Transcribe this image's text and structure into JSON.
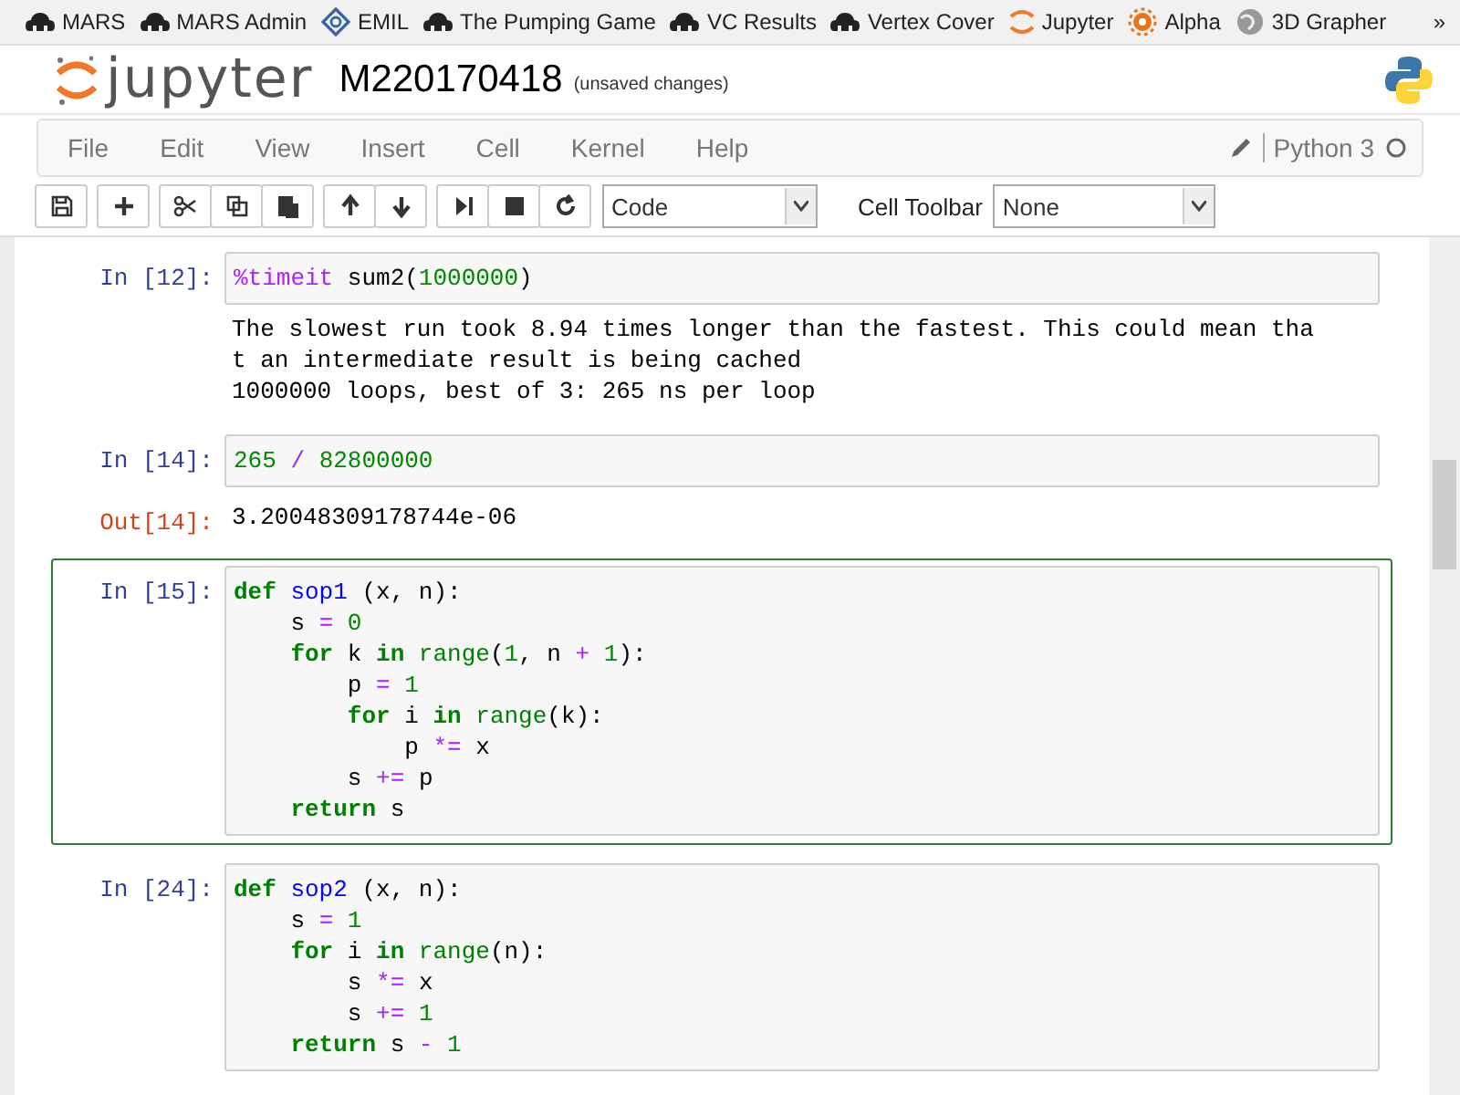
{
  "bookmarks": [
    {
      "label": "MARS",
      "kind": "cloud"
    },
    {
      "label": "MARS Admin",
      "kind": "cloud"
    },
    {
      "label": "EMIL",
      "kind": "diamond"
    },
    {
      "label": "The Pumping Game",
      "kind": "cloud"
    },
    {
      "label": "VC Results",
      "kind": "cloud"
    },
    {
      "label": "Vertex Cover",
      "kind": "cloud"
    },
    {
      "label": "Jupyter",
      "kind": "jupyter"
    },
    {
      "label": "Alpha",
      "kind": "sun"
    },
    {
      "label": "3D Grapher",
      "kind": "globe"
    }
  ],
  "bookmarks_overflow": "»",
  "header": {
    "logo": "jupyter",
    "notebook_name": "M220170418",
    "save_status": "(unsaved changes)"
  },
  "menu": [
    "File",
    "Edit",
    "View",
    "Insert",
    "Cell",
    "Kernel",
    "Help"
  ],
  "kernel": {
    "name": "Python 3",
    "busy": false
  },
  "toolbar": {
    "cell_type": "Code",
    "cell_toolbar_label": "Cell Toolbar",
    "cell_toolbar": "None"
  },
  "cells": [
    {
      "prompt": "In [12]:",
      "selected": false,
      "input": [
        [
          {
            "kind": "magic",
            "t": "%timeit"
          },
          {
            "kind": "plain",
            "t": " sum2("
          },
          {
            "kind": "num",
            "t": "1000000"
          },
          {
            "kind": "plain",
            "t": ")"
          }
        ]
      ],
      "output": {
        "kind": "stream",
        "lines": [
          "The slowest run took 8.94 times longer than the fastest. This could mean tha",
          "t an intermediate result is being cached",
          "1000000 loops, best of 3: 265 ns per loop"
        ]
      }
    },
    {
      "prompt": "In [14]:",
      "selected": false,
      "input": [
        [
          {
            "kind": "num",
            "t": "265"
          },
          {
            "kind": "op",
            "t": " / "
          },
          {
            "kind": "num",
            "t": "82800000"
          }
        ]
      ],
      "output": {
        "kind": "result",
        "prompt": "Out[14]:",
        "lines": [
          "3.20048309178744e-06"
        ]
      }
    },
    {
      "prompt": "In [15]:",
      "selected": true,
      "input": [
        [
          {
            "kind": "kw",
            "t": "def"
          },
          {
            "kind": "fn",
            "t": " sop1"
          },
          {
            "kind": "plain",
            "t": " (x, n):"
          }
        ],
        [
          {
            "kind": "plain",
            "t": "    s"
          },
          {
            "kind": "op",
            "t": " = "
          },
          {
            "kind": "num",
            "t": "0"
          }
        ],
        [
          {
            "kind": "kw",
            "t": "    for"
          },
          {
            "kind": "plain",
            "t": " k "
          },
          {
            "kind": "kw",
            "t": "in"
          },
          {
            "kind": "builtin",
            "t": " range"
          },
          {
            "kind": "plain",
            "t": "("
          },
          {
            "kind": "num",
            "t": "1"
          },
          {
            "kind": "plain",
            "t": ", n"
          },
          {
            "kind": "op",
            "t": " + "
          },
          {
            "kind": "num",
            "t": "1"
          },
          {
            "kind": "plain",
            "t": "):"
          }
        ],
        [
          {
            "kind": "plain",
            "t": "        p"
          },
          {
            "kind": "op",
            "t": " = "
          },
          {
            "kind": "num",
            "t": "1"
          }
        ],
        [
          {
            "kind": "kw",
            "t": "        for"
          },
          {
            "kind": "plain",
            "t": " i "
          },
          {
            "kind": "kw",
            "t": "in"
          },
          {
            "kind": "builtin",
            "t": " range"
          },
          {
            "kind": "plain",
            "t": "(k):"
          }
        ],
        [
          {
            "kind": "plain",
            "t": "            p"
          },
          {
            "kind": "op",
            "t": " *= "
          },
          {
            "kind": "plain",
            "t": "x"
          }
        ],
        [
          {
            "kind": "plain",
            "t": "        s"
          },
          {
            "kind": "op",
            "t": " += "
          },
          {
            "kind": "plain",
            "t": "p"
          }
        ],
        [
          {
            "kind": "kw",
            "t": "    return"
          },
          {
            "kind": "plain",
            "t": " s"
          }
        ]
      ]
    },
    {
      "prompt": "In [24]:",
      "selected": false,
      "input": [
        [
          {
            "kind": "kw",
            "t": "def"
          },
          {
            "kind": "fn",
            "t": " sop2"
          },
          {
            "kind": "plain",
            "t": " (x, n):"
          }
        ],
        [
          {
            "kind": "plain",
            "t": "    s"
          },
          {
            "kind": "op",
            "t": " = "
          },
          {
            "kind": "num",
            "t": "1"
          }
        ],
        [
          {
            "kind": "kw",
            "t": "    for"
          },
          {
            "kind": "plain",
            "t": " i "
          },
          {
            "kind": "kw",
            "t": "in"
          },
          {
            "kind": "builtin",
            "t": " range"
          },
          {
            "kind": "plain",
            "t": "(n):"
          }
        ],
        [
          {
            "kind": "plain",
            "t": "        s"
          },
          {
            "kind": "op",
            "t": " *= "
          },
          {
            "kind": "plain",
            "t": "x"
          }
        ],
        [
          {
            "kind": "plain",
            "t": "        s"
          },
          {
            "kind": "op",
            "t": " += "
          },
          {
            "kind": "num",
            "t": "1"
          }
        ],
        [
          {
            "kind": "kw",
            "t": "    return"
          },
          {
            "kind": "plain",
            "t": " s"
          },
          {
            "kind": "op",
            "t": " - "
          },
          {
            "kind": "num",
            "t": "1"
          }
        ]
      ]
    }
  ]
}
